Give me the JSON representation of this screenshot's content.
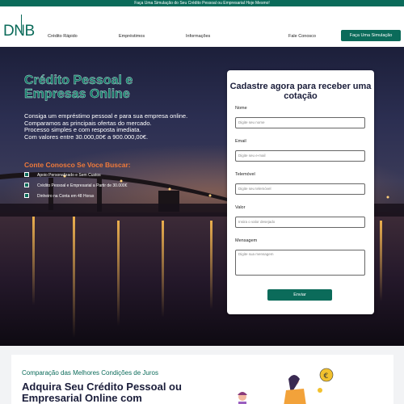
{
  "topbar": {
    "text": "Faça Uma Simulação do Seu Crédito Pessoal ou Empresarial Hoje Mesmo!"
  },
  "brand": {
    "logo": "DNB",
    "color": "#0b6b5a"
  },
  "nav": {
    "links": [
      "Crédito Rápido",
      "Empréstimos",
      "Informações",
      "Fale Conosco"
    ],
    "cta": "Faça Uma Simulação"
  },
  "hero": {
    "title": "Crédito Pessoal e Empresas Online",
    "lines": [
      "Consiga um empréstimo pessoal e para sua empresa online.",
      "Comparamos as principais ofertas do mercado.",
      "Processo simples e com resposta imediata.",
      "Com valores entre 30.000,00€ a 900.000,00€."
    ],
    "subheading": "Conte Conosco Se Voce Buscar:",
    "features": [
      {
        "icon": "checkbox-icon",
        "label": "Apoio Personalizado e Sem Custos"
      },
      {
        "icon": "checkbox-icon",
        "label": "Crédito Pessoal e Empresarial a Partir de 30.000€"
      },
      {
        "icon": "checkbox-icon",
        "label": "Dinheiro na Conta em 48 Horas"
      }
    ]
  },
  "form": {
    "title": "Cadastre agora para receber uma cotação",
    "fields": [
      {
        "label": "Nome",
        "placeholder": "Digite seu nome",
        "value": ""
      },
      {
        "label": "Email",
        "placeholder": "Digite seu e-mail",
        "value": ""
      },
      {
        "label": "Telemóvel",
        "placeholder": "Digite seu telemóvel",
        "value": ""
      },
      {
        "label": "Valor",
        "placeholder": "Insira o valor desejado",
        "value": ""
      }
    ],
    "message": {
      "label": "Mensagem",
      "placeholder": "Digite sua mensagem"
    },
    "submit": "Enviar"
  },
  "section2": {
    "eyebrow": "Comparação das Melhores Condições de Juros",
    "title": "Adquira Seu Crédito Pessoal ou Empresarial Online com"
  }
}
